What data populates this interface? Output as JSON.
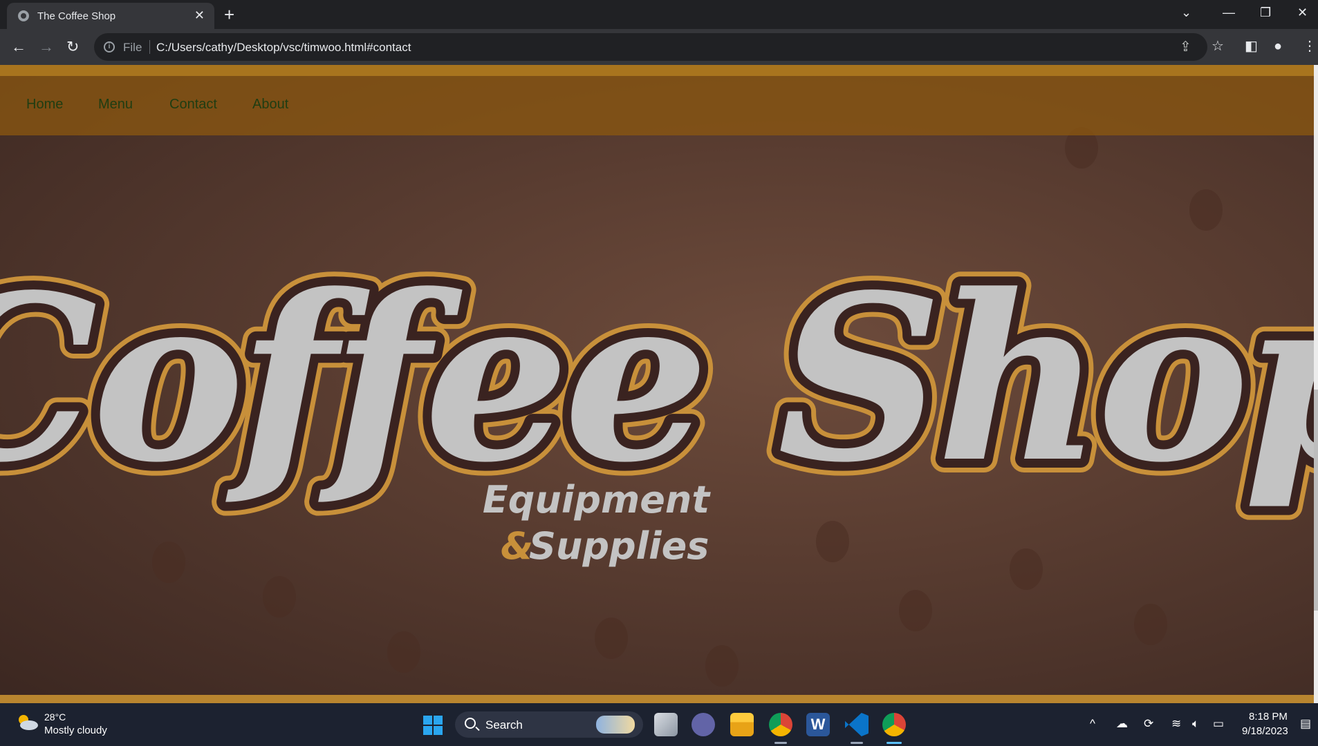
{
  "browser": {
    "tab_title": "The Coffee Shop",
    "new_tab_glyph": "+",
    "close_glyph": "✕",
    "file_label": "File",
    "url": "C:/Users/cathy/Desktop/vsc/timwoo.html#contact",
    "icons": [
      "back-icon",
      "forward-icon",
      "reload-icon",
      "info-icon",
      "share-icon",
      "bookmark-star-icon",
      "side-panel-icon",
      "profile-icon",
      "menu-icon",
      "tab-search-icon",
      "minimize-icon",
      "restore-icon",
      "close-window-icon"
    ]
  },
  "site": {
    "nav": [
      "Home",
      "Menu",
      "Contact",
      "About"
    ],
    "logo": {
      "line1": "Coffee Shop",
      "line2": "Equipment",
      "line3_amp": "&",
      "line3": "Supplies"
    },
    "colors": {
      "nav_bar": "#8c5810",
      "nav_text": "#1f3d12",
      "logo_fill": "#c3c3c3",
      "logo_outline": "#3a2320",
      "logo_gold": "#c8903a",
      "background": "#5a3d31"
    }
  },
  "taskbar": {
    "weather_temp": "28°C",
    "weather_desc": "Mostly cloudy",
    "search_label": "Search",
    "time": "8:18 PM",
    "date": "9/18/2023",
    "apps": [
      "start-icon",
      "task-view-icon",
      "teams-chat-icon",
      "file-explorer-icon",
      "chrome-icon",
      "word-icon",
      "vscode-icon",
      "chrome-active-icon"
    ]
  }
}
